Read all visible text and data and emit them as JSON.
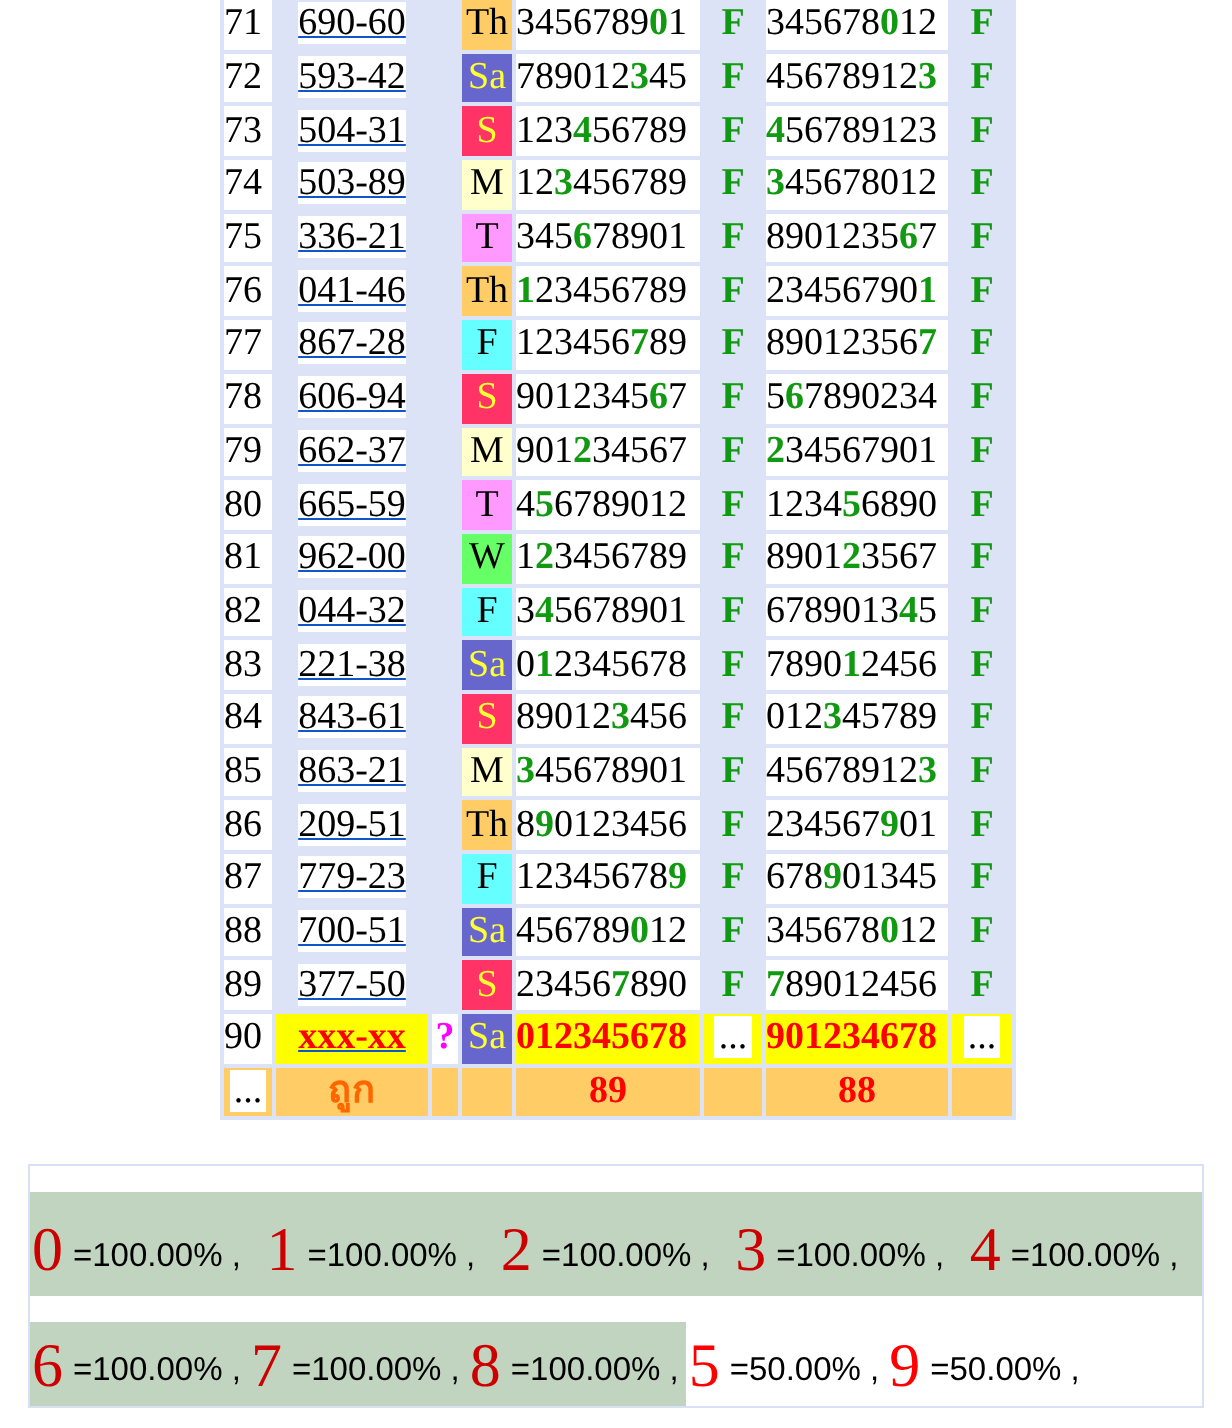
{
  "rows": [
    {
      "no": "71",
      "code": "690-60",
      "day": {
        "label": "Th",
        "color": "#ffcc66"
      },
      "draw_a": "3456789**0**1",
      "mark_a": "F",
      "draw_b": "345678**0**12",
      "mark_b": "F"
    },
    {
      "no": "72",
      "code": "593-42",
      "day": {
        "label": "Sa",
        "color": "#6666cc"
      },
      "draw_a": "789012**3**45",
      "mark_a": "F",
      "draw_b": "45678912**3**",
      "mark_b": "F"
    },
    {
      "no": "73",
      "code": "504-31",
      "day": {
        "label": "S",
        "color": "#ff3366"
      },
      "draw_a": "123**4**56789",
      "mark_a": "F",
      "draw_b": "**4**56789123",
      "mark_b": "F"
    },
    {
      "no": "74",
      "code": "503-89",
      "day": {
        "label": "M",
        "color": "#ffffcc"
      },
      "draw_a": "12**3**456789",
      "mark_a": "F",
      "draw_b": "**3**45678012",
      "mark_b": "F"
    },
    {
      "no": "75",
      "code": "336-21",
      "day": {
        "label": "T",
        "color": "#ff99ff"
      },
      "draw_a": "345**6**78901",
      "mark_a": "F",
      "draw_b": "8901235**6**7",
      "mark_b": "F"
    },
    {
      "no": "76",
      "code": "041-46",
      "day": {
        "label": "Th",
        "color": "#ffcc66"
      },
      "draw_a": "**1**23456789",
      "mark_a": "F",
      "draw_b": "23456790**1**",
      "mark_b": "F"
    },
    {
      "no": "77",
      "code": "867-28",
      "day": {
        "label": "F",
        "color": "#66ffff"
      },
      "draw_a": "123456**7**89",
      "mark_a": "F",
      "draw_b": "89012356**7**",
      "mark_b": "F"
    },
    {
      "no": "78",
      "code": "606-94",
      "day": {
        "label": "S",
        "color": "#ff3366"
      },
      "draw_a": "9012345**6**7",
      "mark_a": "F",
      "draw_b": "5**6**7890234",
      "mark_b": "F"
    },
    {
      "no": "79",
      "code": "662-37",
      "day": {
        "label": "M",
        "color": "#ffffcc"
      },
      "draw_a": "901**2**34567",
      "mark_a": "F",
      "draw_b": "**2**34567901",
      "mark_b": "F"
    },
    {
      "no": "80",
      "code": "665-59",
      "day": {
        "label": "T",
        "color": "#ff99ff"
      },
      "draw_a": "4**5**6789012",
      "mark_a": "F",
      "draw_b": "1234**5**6890",
      "mark_b": "F"
    },
    {
      "no": "81",
      "code": "962-00",
      "day": {
        "label": "W",
        "color": "#66ff66"
      },
      "draw_a": "1**2**3456789",
      "mark_a": "F",
      "draw_b": "8901**2**3567",
      "mark_b": "F"
    },
    {
      "no": "82",
      "code": "044-32",
      "day": {
        "label": "F",
        "color": "#66ffff"
      },
      "draw_a": "3**4**5678901",
      "mark_a": "F",
      "draw_b": "6789013**4**5",
      "mark_b": "F"
    },
    {
      "no": "83",
      "code": "221-38",
      "day": {
        "label": "Sa",
        "color": "#6666cc"
      },
      "draw_a": "0**1**2345678",
      "mark_a": "F",
      "draw_b": "7890**1**2456",
      "mark_b": "F"
    },
    {
      "no": "84",
      "code": "843-61",
      "day": {
        "label": "S",
        "color": "#ff3366"
      },
      "draw_a": "89012**3**456",
      "mark_a": "F",
      "draw_b": "012**3**45789",
      "mark_b": "F"
    },
    {
      "no": "85",
      "code": "863-21",
      "day": {
        "label": "M",
        "color": "#ffffcc"
      },
      "draw_a": "**3**45678901",
      "mark_a": "F",
      "draw_b": "45678912**3**",
      "mark_b": "F"
    },
    {
      "no": "86",
      "code": "209-51",
      "day": {
        "label": "Th",
        "color": "#ffcc66"
      },
      "draw_a": "8**9**0123456",
      "mark_a": "F",
      "draw_b": "234567**9**01",
      "mark_b": "F"
    },
    {
      "no": "87",
      "code": "779-23",
      "day": {
        "label": "F",
        "color": "#66ffff"
      },
      "draw_a": "12345678**9**",
      "mark_a": "F",
      "draw_b": "678**9**01345",
      "mark_b": "F"
    },
    {
      "no": "88",
      "code": "700-51",
      "day": {
        "label": "Sa",
        "color": "#6666cc"
      },
      "draw_a": "456789**0**12",
      "mark_a": "F",
      "draw_b": "345678**0**12",
      "mark_b": "F"
    },
    {
      "no": "89",
      "code": "377-50",
      "day": {
        "label": "S",
        "color": "#ff3366"
      },
      "draw_a": "23456**7**890",
      "mark_a": "F",
      "draw_b": "**7**89012456",
      "mark_b": "F"
    }
  ],
  "pending": {
    "no": "90",
    "code": "xxx-xx",
    "flag": "?",
    "day": {
      "label": "Sa",
      "color": "#6666cc"
    },
    "draw_a": "012345678",
    "mark_a": "...",
    "draw_b": "901234678",
    "mark_b": "..."
  },
  "footer": {
    "col_1": "...",
    "label": "ถูก",
    "count_a": "89",
    "count_b": "88"
  },
  "stats": [
    {
      "digit": "0",
      "rate": "=100.00% ,",
      "hit": true
    },
    {
      "digit": "1",
      "rate": "=100.00% ,",
      "hit": true
    },
    {
      "digit": "2",
      "rate": "=100.00% ,",
      "hit": true
    },
    {
      "digit": "3",
      "rate": "=100.00% ,",
      "hit": true
    },
    {
      "digit": "4",
      "rate": "=100.00% ,",
      "hit": true
    },
    {
      "digit": "6",
      "rate": "=100.00% ,",
      "hit": true
    },
    {
      "digit": "7",
      "rate": "=100.00% ,",
      "hit": true
    },
    {
      "digit": "8",
      "rate": "=100.00% ,",
      "hit": true
    },
    {
      "digit": "5",
      "rate": "=50.00% ,",
      "hit": false
    },
    {
      "digit": "9",
      "rate": "=50.00% ,",
      "hit": false
    }
  ]
}
